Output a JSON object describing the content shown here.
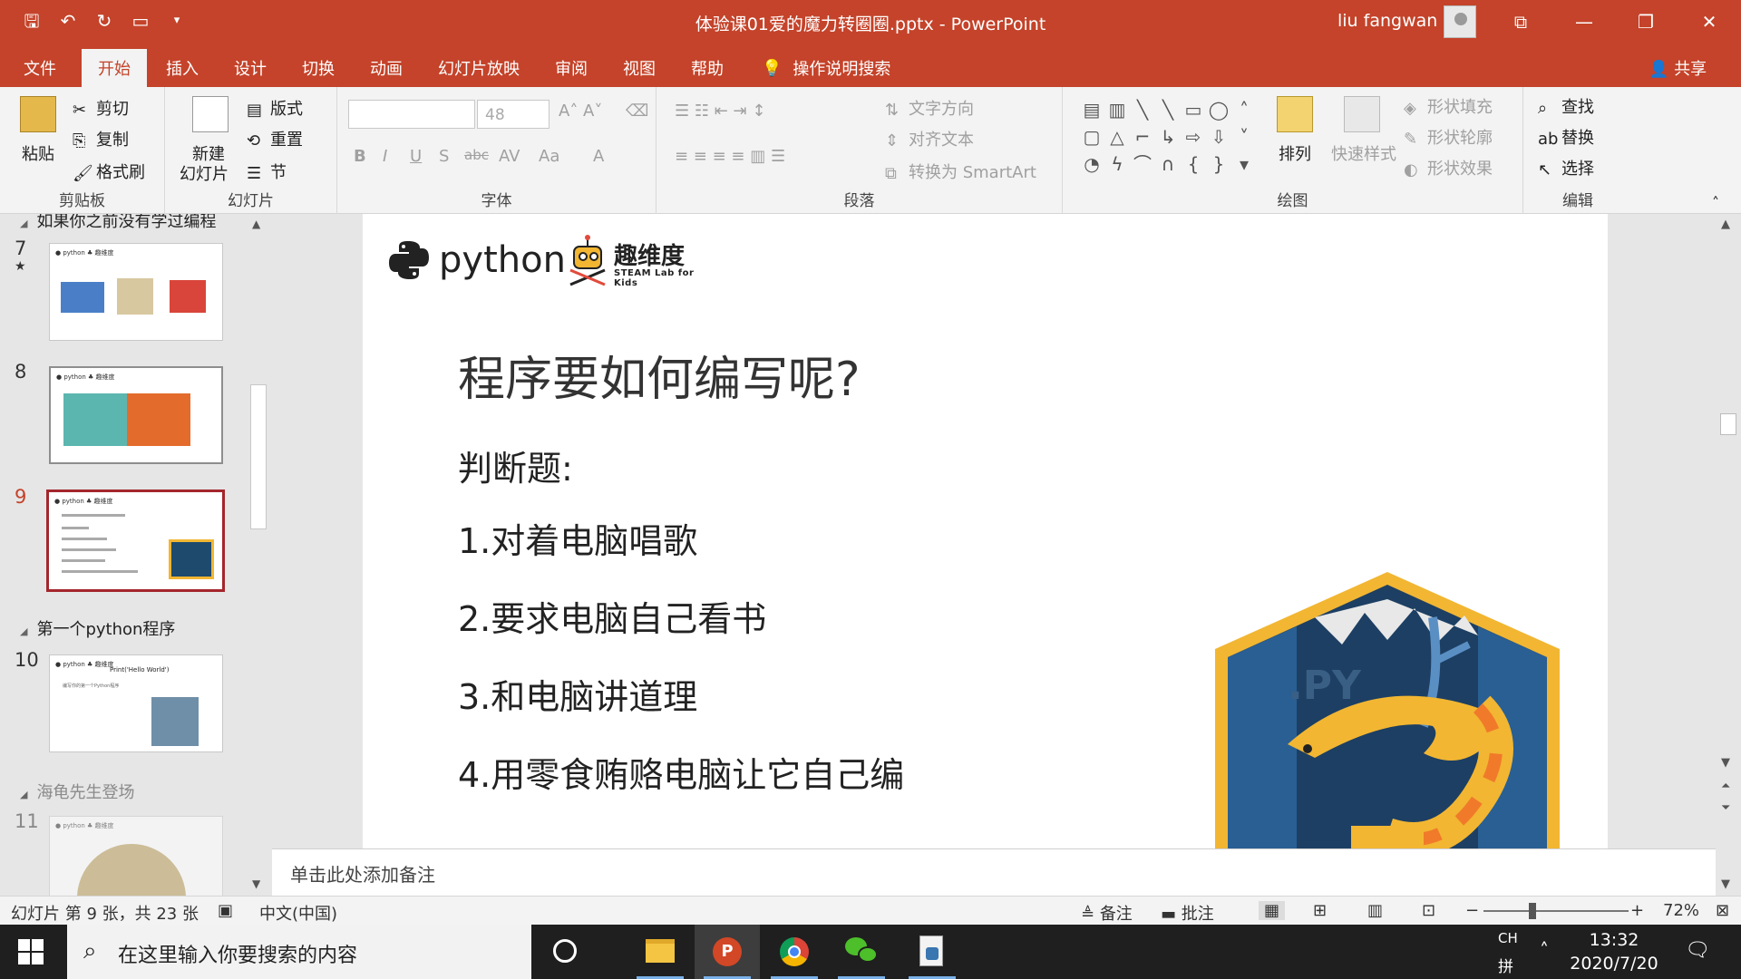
{
  "window": {
    "title": "体验课01爱的魔力转圈圈.pptx  -  PowerPoint",
    "user": "liu fangwan"
  },
  "tabs": [
    "文件",
    "开始",
    "插入",
    "设计",
    "切换",
    "动画",
    "幻灯片放映",
    "审阅",
    "视图",
    "帮助"
  ],
  "search_tab": "操作说明搜索",
  "share": "共享",
  "ribbon": {
    "clipboard": {
      "label": "剪贴板",
      "paste": "粘贴",
      "cut": "剪切",
      "copy": "复制",
      "format_painter": "格式刷"
    },
    "slides": {
      "label": "幻灯片",
      "new_slide_1": "新建",
      "new_slide_2": "幻灯片",
      "layout": "版式",
      "reset": "重置",
      "section": "节"
    },
    "font": {
      "label": "字体",
      "font_size": "48",
      "bold": "B",
      "italic": "I",
      "underline": "U",
      "shadow": "S",
      "strike": "abc",
      "spacing": "AV",
      "case": "Aa",
      "color": "A"
    },
    "paragraph": {
      "label": "段落",
      "text_direction": "文字方向",
      "align_text": "对齐文本",
      "convert_smartart": "转换为 SmartArt"
    },
    "drawing": {
      "label": "绘图",
      "arrange": "排列",
      "quick_styles": "快速样式",
      "shape_fill": "形状填充",
      "shape_outline": "形状轮廓",
      "shape_effects": "形状效果"
    },
    "editing": {
      "label": "编辑",
      "find": "查找",
      "replace": "替换",
      "select": "选择"
    }
  },
  "slide_panel": {
    "section_top": "如果你之前没有学过编程",
    "section_first_python": "第一个python程序",
    "section_turtle": "海龟先生登场",
    "slide_numbers": [
      "7",
      "8",
      "9",
      "10",
      "11"
    ],
    "thumb10_text": "Print('Hello World')",
    "thumb10_sub": "编写你的第一个Python程序"
  },
  "slide": {
    "python_logo": "python",
    "qwd_logo": "趣维度",
    "qwd_sub": "STEAM Lab for Kids",
    "title": "程序要如何编写呢?",
    "lines": [
      "判断题:",
      "1.对着电脑唱歌",
      "2.要求电脑自己看书",
      "3.和电脑讲道理",
      "4.用零食贿赂电脑让它自己编"
    ],
    "art_text": ".PY"
  },
  "notes_placeholder": "单击此处添加备注",
  "status": {
    "slide_info": "幻灯片 第 9 张，共 23 张",
    "language": "中文(中国)",
    "notes": "备注",
    "comments": "批注",
    "zoom": "72%"
  },
  "taskbar": {
    "search_placeholder": "在这里输入你要搜索的内容",
    "lang": "CH",
    "ime": "拼",
    "time": "13:32",
    "date": "2020/7/20"
  },
  "colors": {
    "accent": "#c4432a",
    "selected_thumb": "#a4262c",
    "taskbar": "#1f1f1f"
  }
}
